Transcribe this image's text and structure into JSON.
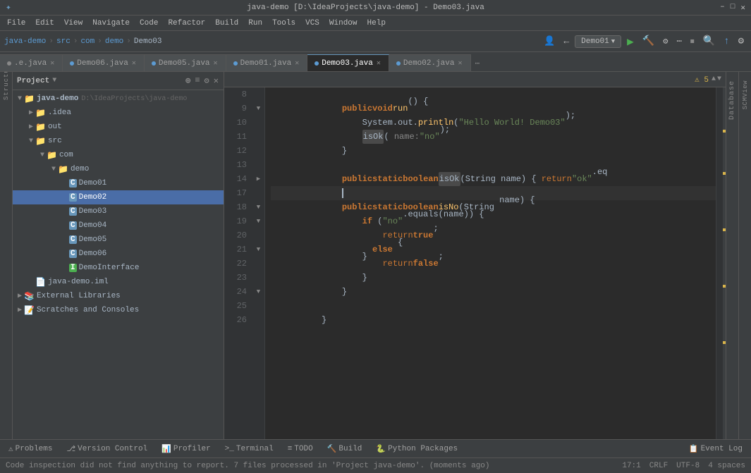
{
  "window": {
    "title": "java-demo [D:\\IdeaProjects\\java-demo] - Demo03.java",
    "titlebar_buttons": [
      "–",
      "□",
      "✕"
    ]
  },
  "menu": {
    "items": [
      "File",
      "Edit",
      "View",
      "Navigate",
      "Code",
      "Refactor",
      "Build",
      "Run",
      "Tools",
      "VCS",
      "Window",
      "Help"
    ]
  },
  "toolbar": {
    "breadcrumb": [
      "java-demo",
      "src",
      "com",
      "demo",
      "Demo03"
    ],
    "run_config": "Demo01",
    "buttons": [
      "▶",
      "🐞",
      "⚙",
      "📦",
      "▶▶",
      "⏹",
      "⏸"
    ]
  },
  "tabs": [
    {
      "label": ".e.java",
      "active": false,
      "color": "gray"
    },
    {
      "label": "Demo06.java",
      "active": false,
      "color": "blue"
    },
    {
      "label": "Demo05.java",
      "active": false,
      "color": "blue"
    },
    {
      "label": "Demo01.java",
      "active": false,
      "color": "blue"
    },
    {
      "label": "Demo03.java",
      "active": true,
      "color": "blue"
    },
    {
      "label": "Demo02.java",
      "active": false,
      "color": "blue"
    }
  ],
  "warnings": {
    "count": "⚠ 5",
    "up": "▲",
    "down": "▼"
  },
  "project_panel": {
    "title": "Project",
    "icons": [
      "🔀",
      "≡",
      "⊕",
      "⚙"
    ],
    "tree": [
      {
        "level": 0,
        "label": "java-demo",
        "sub": "D:\\IdeaProjects\\java-demo",
        "type": "root",
        "expanded": true,
        "arrow": "▼"
      },
      {
        "level": 1,
        "label": ".idea",
        "type": "folder",
        "expanded": false,
        "arrow": "▶"
      },
      {
        "level": 1,
        "label": "out",
        "type": "folder",
        "expanded": false,
        "arrow": "▶"
      },
      {
        "level": 1,
        "label": "src",
        "type": "src",
        "expanded": true,
        "arrow": "▼"
      },
      {
        "level": 2,
        "label": "com",
        "type": "folder",
        "expanded": true,
        "arrow": "▼"
      },
      {
        "level": 3,
        "label": "demo",
        "type": "folder",
        "expanded": true,
        "arrow": "▼"
      },
      {
        "level": 4,
        "label": "Demo01",
        "type": "class",
        "selected": false
      },
      {
        "level": 4,
        "label": "Demo02",
        "type": "class",
        "selected": true
      },
      {
        "level": 4,
        "label": "Demo03",
        "type": "class",
        "selected": false
      },
      {
        "level": 4,
        "label": "Demo04",
        "type": "class",
        "selected": false
      },
      {
        "level": 4,
        "label": "Demo05",
        "type": "class",
        "selected": false
      },
      {
        "level": 4,
        "label": "Demo06",
        "type": "class",
        "selected": false
      },
      {
        "level": 4,
        "label": "DemoInterface",
        "type": "interface",
        "selected": false
      },
      {
        "level": 1,
        "label": "java-demo.iml",
        "type": "iml"
      },
      {
        "level": 0,
        "label": "External Libraries",
        "type": "lib",
        "arrow": "▶"
      },
      {
        "level": 0,
        "label": "Scratches and Consoles",
        "type": "scratch",
        "arrow": "▶"
      }
    ]
  },
  "code": {
    "lines": [
      {
        "num": 8,
        "content": "",
        "gutter": ""
      },
      {
        "num": 9,
        "content": "    public void run() {",
        "gutter": "▼"
      },
      {
        "num": 10,
        "content": "        System.out.println(\"Hello World! Demo03\");",
        "gutter": ""
      },
      {
        "num": 11,
        "content": "        isOk( name: \"no\");",
        "gutter": ""
      },
      {
        "num": 12,
        "content": "    }",
        "gutter": ""
      },
      {
        "num": 13,
        "content": "",
        "gutter": ""
      },
      {
        "num": 14,
        "content": "    public static boolean isOk(String name) { return \"ok\".eq",
        "gutter": "▶"
      },
      {
        "num": 17,
        "content": "",
        "gutter": "",
        "current": true
      },
      {
        "num": 18,
        "content": "    public static boolean isNo(String name) {",
        "gutter": "▼"
      },
      {
        "num": 19,
        "content": "        if (\"no\".equals(name)) {",
        "gutter": "▼"
      },
      {
        "num": 20,
        "content": "            return true;",
        "gutter": ""
      },
      {
        "num": 21,
        "content": "        } else {",
        "gutter": "▼"
      },
      {
        "num": 22,
        "content": "            return false;",
        "gutter": ""
      },
      {
        "num": 23,
        "content": "        }",
        "gutter": ""
      },
      {
        "num": 24,
        "content": "    }",
        "gutter": "▼"
      },
      {
        "num": 25,
        "content": "",
        "gutter": ""
      },
      {
        "num": 26,
        "content": "}",
        "gutter": ""
      }
    ]
  },
  "bottom_tabs": [
    {
      "label": "Problems",
      "icon": "⚠"
    },
    {
      "label": "Version Control",
      "icon": "⎇"
    },
    {
      "label": "Profiler",
      "icon": "📊"
    },
    {
      "label": "Terminal",
      "icon": ">"
    },
    {
      "label": "TODO",
      "icon": "≡"
    },
    {
      "label": "Build",
      "icon": "🔨"
    },
    {
      "label": "Python Packages",
      "icon": "🐍"
    },
    {
      "label": "Event Log",
      "icon": "📋"
    }
  ],
  "status_bar": {
    "message": "Code inspection did not find anything to report. 7 files processed in 'Project java-demo'. (moments ago)",
    "position": "17:1",
    "line_ending": "CRLF",
    "encoding": "UTF-8",
    "indent": "4 spaces"
  },
  "right_panels": {
    "database": "Database",
    "scm_view": "SCMView"
  }
}
